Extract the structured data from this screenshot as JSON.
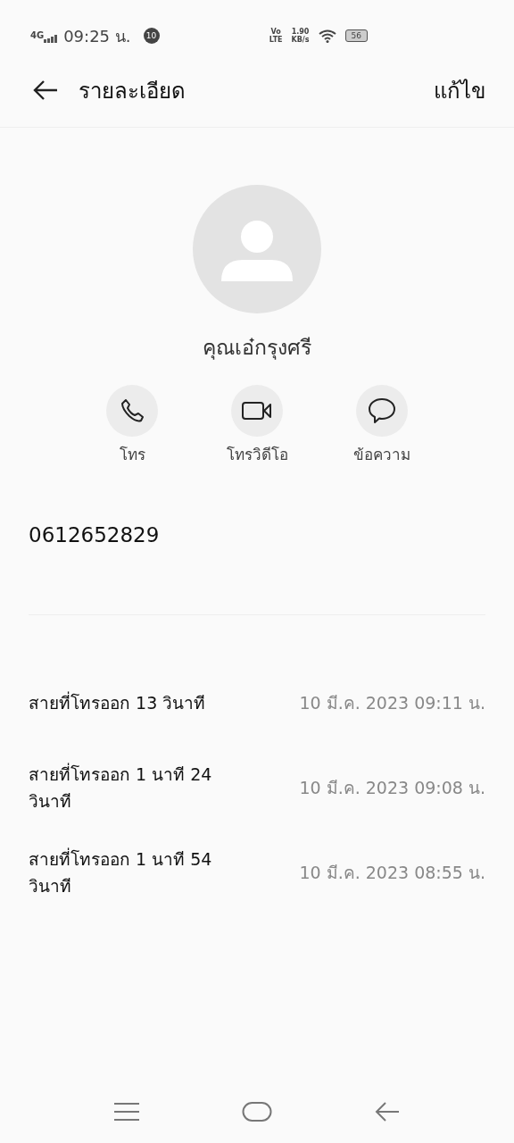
{
  "status_bar": {
    "network": "4G",
    "time": "09:25 น.",
    "notification_badge": "10",
    "volte_top": "Vo",
    "volte_bottom": "LTE",
    "speed": "1.90",
    "speed_unit": "KB/s",
    "battery": "56"
  },
  "header": {
    "title": "รายละเอียด",
    "edit": "แก้ไข"
  },
  "contact": {
    "name": "คุณเอ๋กรุงศรี",
    "phone": "0612652829"
  },
  "actions": [
    {
      "kind": "call",
      "label": "โทร"
    },
    {
      "kind": "video",
      "label": "โทรวิดีโอ"
    },
    {
      "kind": "message",
      "label": "ข้อความ"
    }
  ],
  "call_log": [
    {
      "description": "สายที่โทรออก 13 วินาที",
      "time": "10 มี.ค. 2023 09:11 น."
    },
    {
      "description": "สายที่โทรออก 1 นาที 24 วินาที",
      "time": "10 มี.ค. 2023 09:08 น."
    },
    {
      "description": "สายที่โทรออก 1 นาที 54 วินาที",
      "time": "10 มี.ค. 2023 08:55 น."
    }
  ]
}
